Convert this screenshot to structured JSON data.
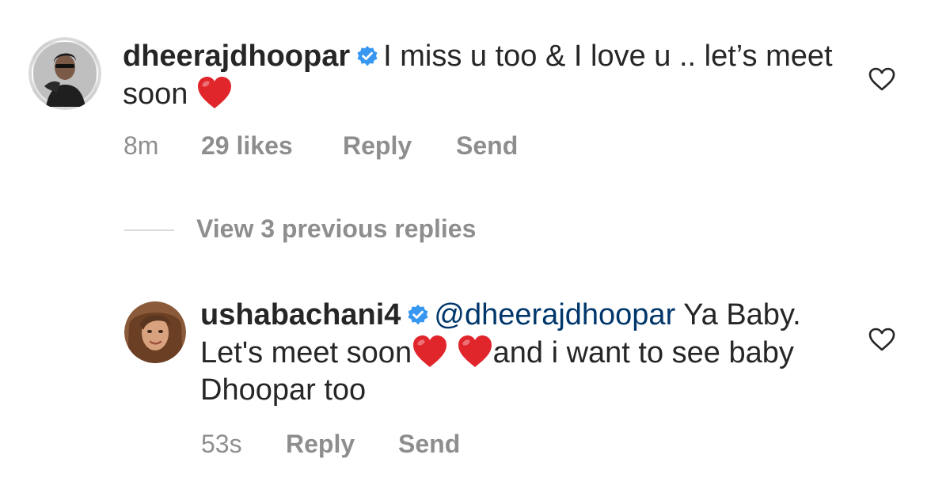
{
  "colors": {
    "text_primary": "#262626",
    "text_secondary": "#8e8e8e",
    "mention": "#00376b",
    "verified_badge": "#3897f0",
    "heart_emoji": "#e0252b",
    "divider": "#dbdbdb"
  },
  "comments": [
    {
      "username": "dheerajdhoopar",
      "verified": true,
      "text_part1": "I miss u too & I love u .. let’s meet soon",
      "emoji": "heart-emoji",
      "time": "8m",
      "likes": "29 likes",
      "reply_label": "Reply",
      "send_label": "Send",
      "like_icon": "heart-outline-icon"
    },
    {
      "username": "ushabachani4",
      "verified": true,
      "mention": "@dheerajdhoopar",
      "text_part1": "Ya Baby. Let's meet soon",
      "emojis": [
        "heart-emoji",
        "heart-emoji"
      ],
      "text_part2": "and i want to see baby Dhoopar too",
      "time": "53s",
      "reply_label": "Reply",
      "send_label": "Send",
      "like_icon": "heart-outline-icon"
    }
  ],
  "view_replies_label": "View 3 previous replies"
}
